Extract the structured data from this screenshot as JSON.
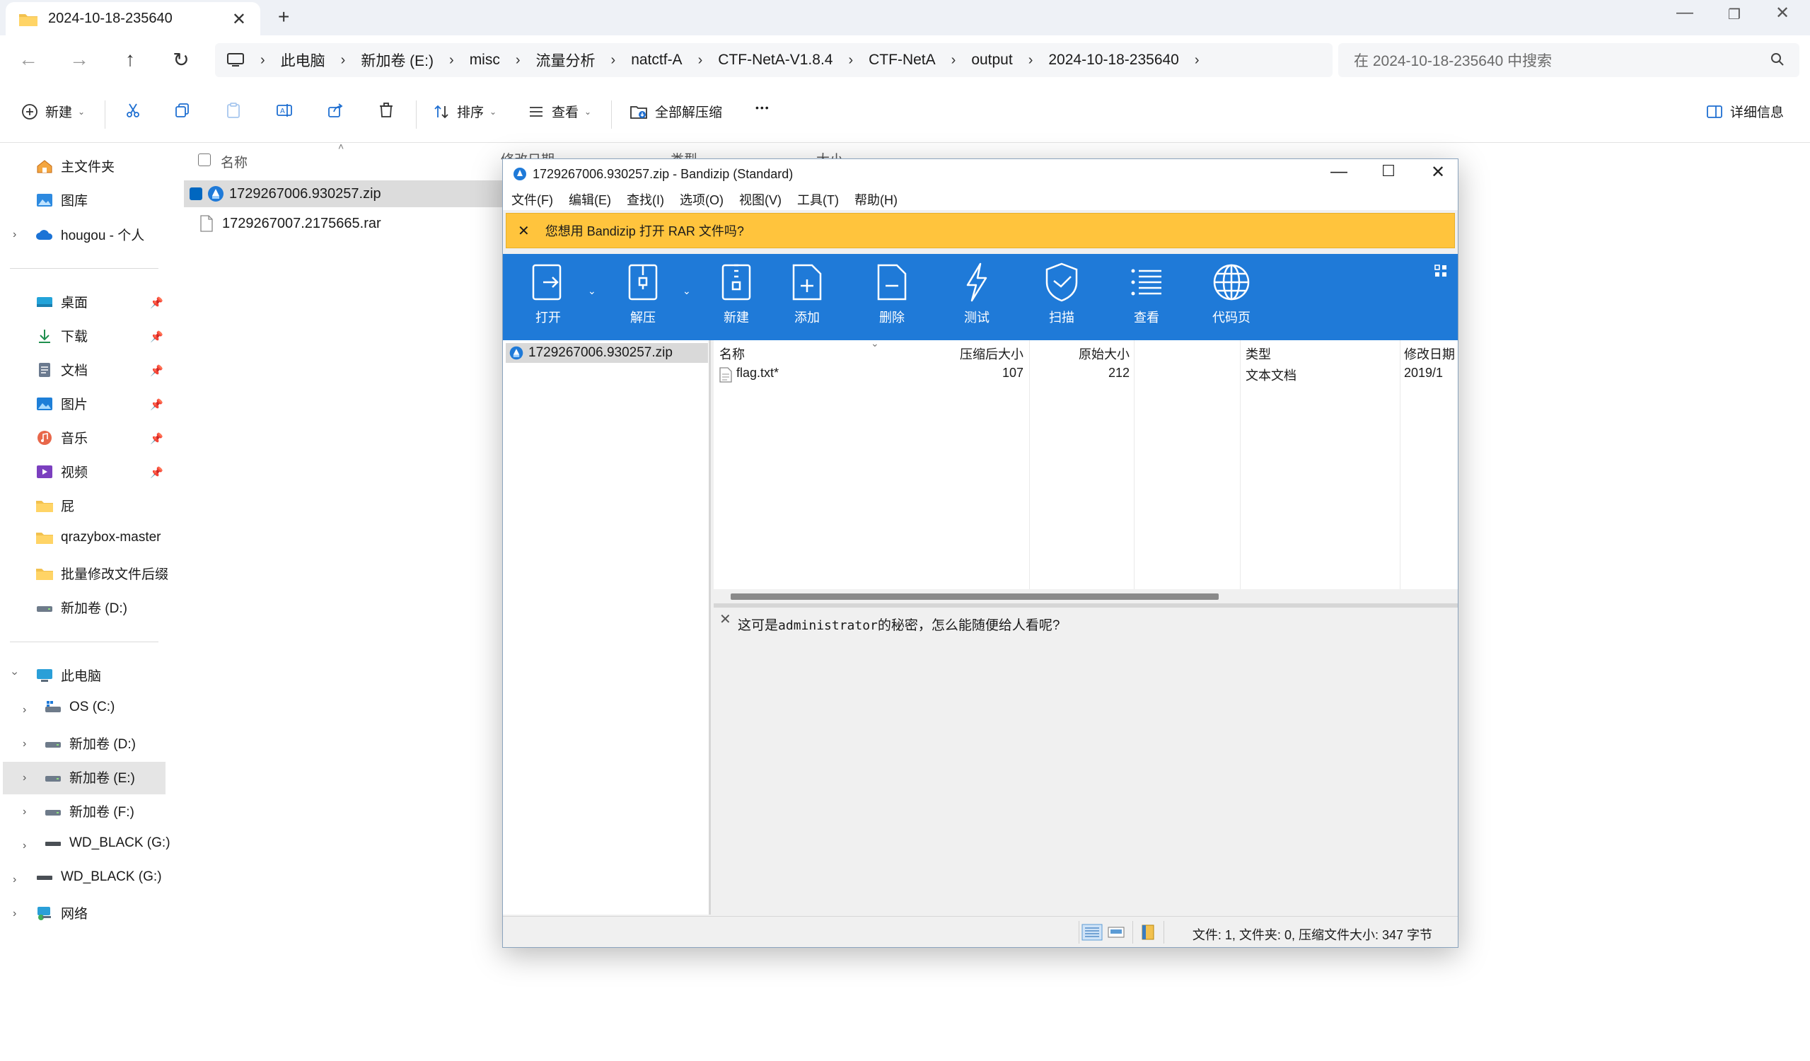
{
  "tab": {
    "title": "2024-10-18-235640",
    "close": "✕",
    "new": "+"
  },
  "window_controls": {
    "minimize": "—",
    "restore": "❐",
    "close": "✕"
  },
  "breadcrumb": [
    "此电脑",
    "新加卷 (E:)",
    "misc",
    "流量分析",
    "natctf-A",
    "CTF-NetA-V1.8.4",
    "CTF-NetA",
    "output",
    "2024-10-18-235640"
  ],
  "search": {
    "placeholder": "在 2024-10-18-235640 中搜索"
  },
  "commands": {
    "new": "新建",
    "sort": "排序",
    "view": "查看",
    "extract_all": "全部解压缩",
    "more": "•••",
    "details": "详细信息"
  },
  "sidebar": {
    "home": "主文件夹",
    "gallery": "图库",
    "onedrive": "hougou - 个人",
    "quick": [
      "桌面",
      "下载",
      "文档",
      "图片",
      "音乐",
      "视频",
      "屁",
      "qrazybox-master",
      "批量修改文件后缀",
      "新加卷 (D:)"
    ],
    "this_pc": "此电脑",
    "drives": [
      "OS (C:)",
      "新加卷 (D:)",
      "新加卷 (E:)",
      "新加卷 (F:)",
      "WD_BLACK (G:)"
    ],
    "wd_black": "WD_BLACK (G:)",
    "network": "网络"
  },
  "filelist": {
    "headers": {
      "name": "名称",
      "modified": "修改日期",
      "type": "类型",
      "size": "大小"
    },
    "files": [
      "1729267006.930257.zip",
      "1729267007.2175665.rar"
    ]
  },
  "bandizip": {
    "title": "1729267006.930257.zip - Bandizip (Standard)",
    "menu": [
      "文件(F)",
      "编辑(E)",
      "查找(I)",
      "选项(O)",
      "视图(V)",
      "工具(T)",
      "帮助(H)"
    ],
    "notice": "您想用 Bandizip 打开 RAR 文件吗?",
    "toolbar": [
      "打开",
      "解压",
      "新建",
      "添加",
      "删除",
      "测试",
      "扫描",
      "查看",
      "代码页"
    ],
    "tree_item": "1729267006.930257.zip",
    "columns": {
      "name": "名称",
      "packed": "压缩后大小",
      "original": "原始大小",
      "type": "类型",
      "modified": "修改日期"
    },
    "rows": [
      {
        "name": "flag.txt*",
        "packed": "107",
        "original": "212",
        "type": "文本文档",
        "modified": "2019/1"
      }
    ],
    "comment_pre": "这可是",
    "comment_mono": "administrator",
    "comment_post": "的秘密，怎么能随便给人看呢?",
    "status": "文件: 1, 文件夹: 0, 压缩文件大小: 347 字节"
  },
  "colors": {
    "accent": "#1f7ad8",
    "notice": "#ffc43d",
    "select": "#0067c0"
  }
}
